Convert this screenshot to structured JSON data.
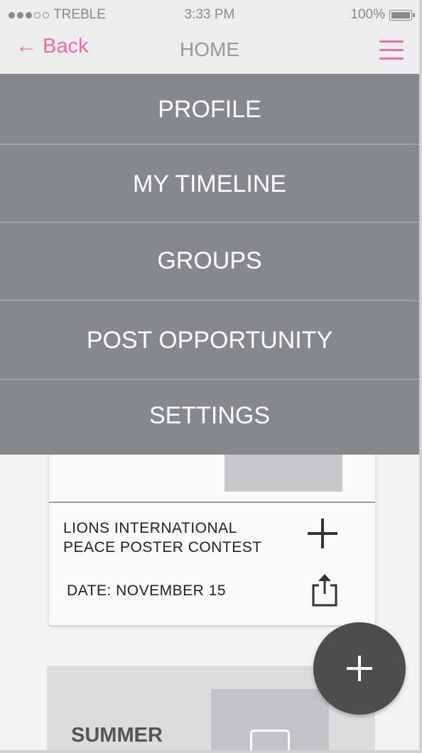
{
  "status_bar": {
    "carrier": "TREBLE",
    "time": "3:33 PM",
    "battery": "100%"
  },
  "nav": {
    "back_label": "Back",
    "title": "HOME"
  },
  "menu": {
    "items": [
      {
        "label": "PROFILE"
      },
      {
        "label": "MY TIMELINE"
      },
      {
        "label": "GROUPS"
      },
      {
        "label": "POST OPPORTUNITY"
      },
      {
        "label": "SETTINGS"
      }
    ]
  },
  "card": {
    "name_line1": "LIONS INTERNATIONAL",
    "name_line2": "PEACE POSTER CONTEST",
    "date": "DATE: NOVEMBER 15"
  },
  "card2": {
    "title": "SUMMER"
  },
  "colors": {
    "accent": "#ef6aa8",
    "menu_bg": "#87888b",
    "fab_bg": "#4d4d4d"
  },
  "icons": [
    "back-arrow-icon",
    "hamburger-icon",
    "plus-icon",
    "share-icon",
    "image-icon",
    "battery-icon",
    "signal-dots-icon"
  ]
}
